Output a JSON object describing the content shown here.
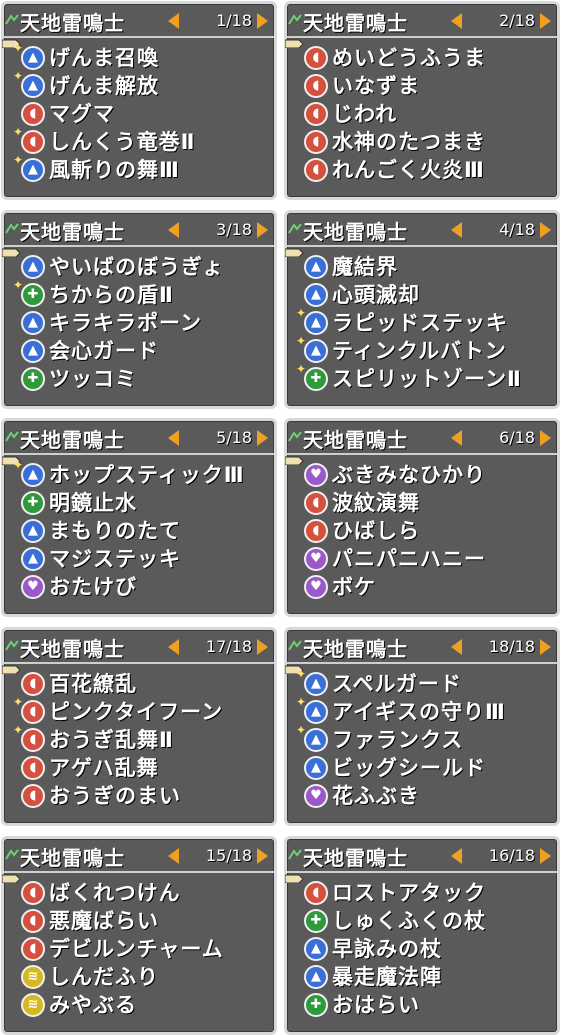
{
  "panels": [
    {
      "title": "天地雷鳴士",
      "page": "1/18",
      "items": [
        {
          "name": "げんま召喚",
          "type": "blue",
          "spark": true
        },
        {
          "name": "げんま解放",
          "type": "blue",
          "spark": true
        },
        {
          "name": "マグマ",
          "type": "red",
          "spark": false
        },
        {
          "name": "しんくう竜巻Ⅱ",
          "type": "red",
          "spark": true
        },
        {
          "name": "風斬りの舞Ⅲ",
          "type": "blue",
          "spark": true
        }
      ]
    },
    {
      "title": "天地雷鳴士",
      "page": "2/18",
      "items": [
        {
          "name": "めいどうふうま",
          "type": "red",
          "spark": false
        },
        {
          "name": "いなずま",
          "type": "red",
          "spark": false
        },
        {
          "name": "じわれ",
          "type": "red",
          "spark": false
        },
        {
          "name": "水神のたつまき",
          "type": "red",
          "spark": false
        },
        {
          "name": "れんごく火炎Ⅲ",
          "type": "red",
          "spark": false
        }
      ]
    },
    {
      "title": "天地雷鳴士",
      "page": "3/18",
      "items": [
        {
          "name": "やいばのぼうぎょ",
          "type": "blue",
          "spark": false
        },
        {
          "name": "ちからの盾Ⅱ",
          "type": "green",
          "spark": true
        },
        {
          "name": "キラキラポーン",
          "type": "blue",
          "spark": false
        },
        {
          "name": "会心ガード",
          "type": "blue",
          "spark": false
        },
        {
          "name": "ツッコミ",
          "type": "green",
          "spark": false
        }
      ]
    },
    {
      "title": "天地雷鳴士",
      "page": "4/18",
      "items": [
        {
          "name": "魔結界",
          "type": "blue",
          "spark": false
        },
        {
          "name": "心頭滅却",
          "type": "blue",
          "spark": false
        },
        {
          "name": "ラピッドステッキ",
          "type": "blue",
          "spark": true
        },
        {
          "name": "ティンクルバトン",
          "type": "blue",
          "spark": true
        },
        {
          "name": "スピリットゾーンⅡ",
          "type": "green",
          "spark": true
        }
      ]
    },
    {
      "title": "天地雷鳴士",
      "page": "5/18",
      "items": [
        {
          "name": "ホップスティックⅢ",
          "type": "blue",
          "spark": true
        },
        {
          "name": "明鏡止水",
          "type": "green",
          "spark": false
        },
        {
          "name": "まもりのたて",
          "type": "blue",
          "spark": false
        },
        {
          "name": "マジステッキ",
          "type": "blue",
          "spark": false
        },
        {
          "name": "おたけび",
          "type": "purple",
          "spark": false
        }
      ]
    },
    {
      "title": "天地雷鳴士",
      "page": "6/18",
      "items": [
        {
          "name": "ぶきみなひかり",
          "type": "purple",
          "spark": false
        },
        {
          "name": "波紋演舞",
          "type": "red",
          "spark": false
        },
        {
          "name": "ひばしら",
          "type": "red",
          "spark": false
        },
        {
          "name": "パニパニハニー",
          "type": "purple",
          "spark": false
        },
        {
          "name": "ボケ",
          "type": "purple",
          "spark": false
        }
      ]
    },
    {
      "title": "天地雷鳴士",
      "page": "17/18",
      "items": [
        {
          "name": "百花繚乱",
          "type": "red",
          "spark": false
        },
        {
          "name": "ピンクタイフーン",
          "type": "red",
          "spark": true
        },
        {
          "name": "おうぎ乱舞Ⅱ",
          "type": "red",
          "spark": true
        },
        {
          "name": "アゲハ乱舞",
          "type": "red",
          "spark": false
        },
        {
          "name": "おうぎのまい",
          "type": "red",
          "spark": false
        }
      ]
    },
    {
      "title": "天地雷鳴士",
      "page": "18/18",
      "items": [
        {
          "name": "スペルガード",
          "type": "blue",
          "spark": true
        },
        {
          "name": "アイギスの守りⅢ",
          "type": "blue",
          "spark": true
        },
        {
          "name": "ファランクス",
          "type": "blue",
          "spark": true
        },
        {
          "name": "ビッグシールド",
          "type": "blue",
          "spark": false
        },
        {
          "name": "花ふぶき",
          "type": "purple",
          "spark": false
        }
      ]
    },
    {
      "title": "天地雷鳴士",
      "page": "15/18",
      "items": [
        {
          "name": "ばくれつけん",
          "type": "red",
          "spark": false
        },
        {
          "name": "悪魔ばらい",
          "type": "red",
          "spark": false
        },
        {
          "name": "デビルンチャーム",
          "type": "red",
          "spark": false
        },
        {
          "name": "しんだふり",
          "type": "yellow",
          "spark": false
        },
        {
          "name": "みやぶる",
          "type": "yellow",
          "spark": false
        }
      ]
    },
    {
      "title": "天地雷鳴士",
      "page": "16/18",
      "items": [
        {
          "name": "ロストアタック",
          "type": "red",
          "spark": false
        },
        {
          "name": "しゅくふくの杖",
          "type": "green",
          "spark": false
        },
        {
          "name": "早詠みの杖",
          "type": "blue",
          "spark": false
        },
        {
          "name": "暴走魔法陣",
          "type": "blue",
          "spark": false
        },
        {
          "name": "おはらい",
          "type": "green",
          "spark": false
        }
      ]
    }
  ]
}
